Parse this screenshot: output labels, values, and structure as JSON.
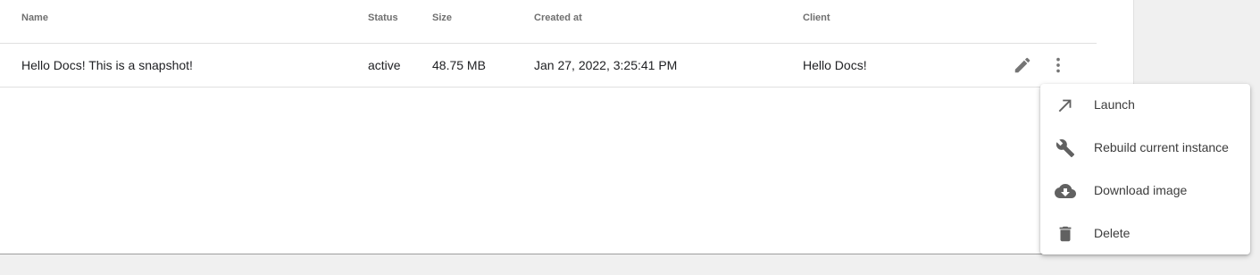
{
  "table": {
    "columns": {
      "name": "Name",
      "status": "Status",
      "size": "Size",
      "created_at": "Created at",
      "client": "Client"
    },
    "rows": [
      {
        "name": "Hello Docs! This is a snapshot!",
        "status": "active",
        "size": "48.75 MB",
        "created_at": "Jan 27, 2022, 3:25:41 PM",
        "client": "Hello Docs!"
      }
    ],
    "row_actions": {
      "edit_icon": "pencil-icon",
      "more_icon": "more-vert-icon"
    }
  },
  "menu": {
    "items": [
      {
        "label": "Launch",
        "icon": "arrow-up-right-icon"
      },
      {
        "label": "Rebuild current instance",
        "icon": "wrench-icon"
      },
      {
        "label": "Download image",
        "icon": "cloud-download-icon"
      },
      {
        "label": "Delete",
        "icon": "trash-icon"
      }
    ]
  },
  "colors": {
    "icon_gray": "#757575",
    "menu_icon_gray": "#616161"
  }
}
